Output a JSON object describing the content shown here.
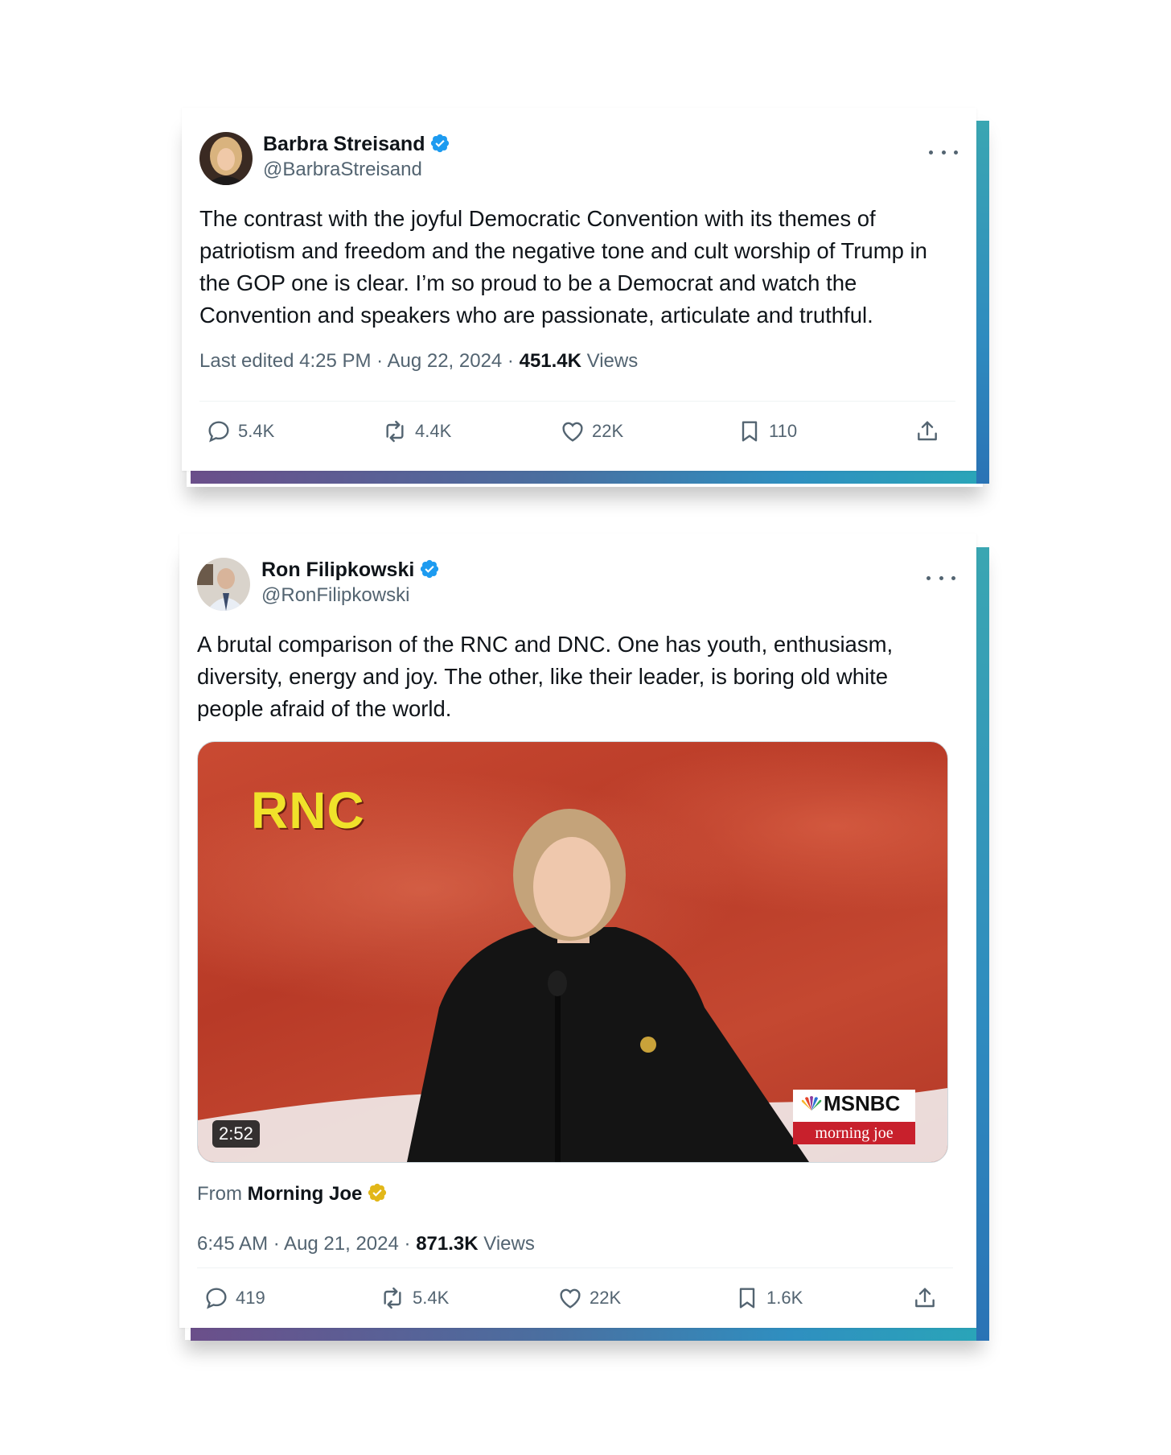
{
  "tweets": [
    {
      "name": "Barbra Streisand",
      "handle": "@BarbraStreisand",
      "text": "The contrast with the joyful Democratic Convention with its themes of patriotism and freedom and the negative tone and cult worship of Trump in the GOP one is clear. I’m so proud to be a Democrat and watch the Convention and speakers who are passionate, articulate and truthful.",
      "timestamp": "Last edited 4:25 PM · Aug 22, 2024 · ",
      "views_count": "451.4K",
      "views_label": " Views",
      "replies": "5.4K",
      "reposts": "4.4K",
      "likes": "22K",
      "bookmarks": "110"
    },
    {
      "name": "Ron Filipkowski",
      "handle": "@RonFilipkowski",
      "text": "A brutal comparison of the RNC and DNC. One has youth, enthusiasm, diversity, energy and joy. The other, like their leader, is boring old white people afraid of the world.",
      "media": {
        "overlay_text": "RNC",
        "duration": "2:52",
        "network": "MSNBC",
        "show": "morning joe"
      },
      "from_label": "From ",
      "from_source": "Morning Joe",
      "timestamp": "6:45 AM · Aug 21, 2024 · ",
      "views_count": "871.3K",
      "views_label": " Views",
      "replies": "419",
      "reposts": "5.4K",
      "likes": "22K",
      "bookmarks": "1.6K"
    }
  ],
  "colors": {
    "verified_blue": "#1d9bf0",
    "verified_gold": "#e2b719",
    "accent_gradient_start": "#6b4f8a",
    "accent_gradient_end": "#2aa6b8"
  },
  "icons": [
    "verified-badge-icon",
    "more-icon",
    "reply-icon",
    "repost-icon",
    "like-icon",
    "bookmark-icon",
    "share-icon"
  ]
}
